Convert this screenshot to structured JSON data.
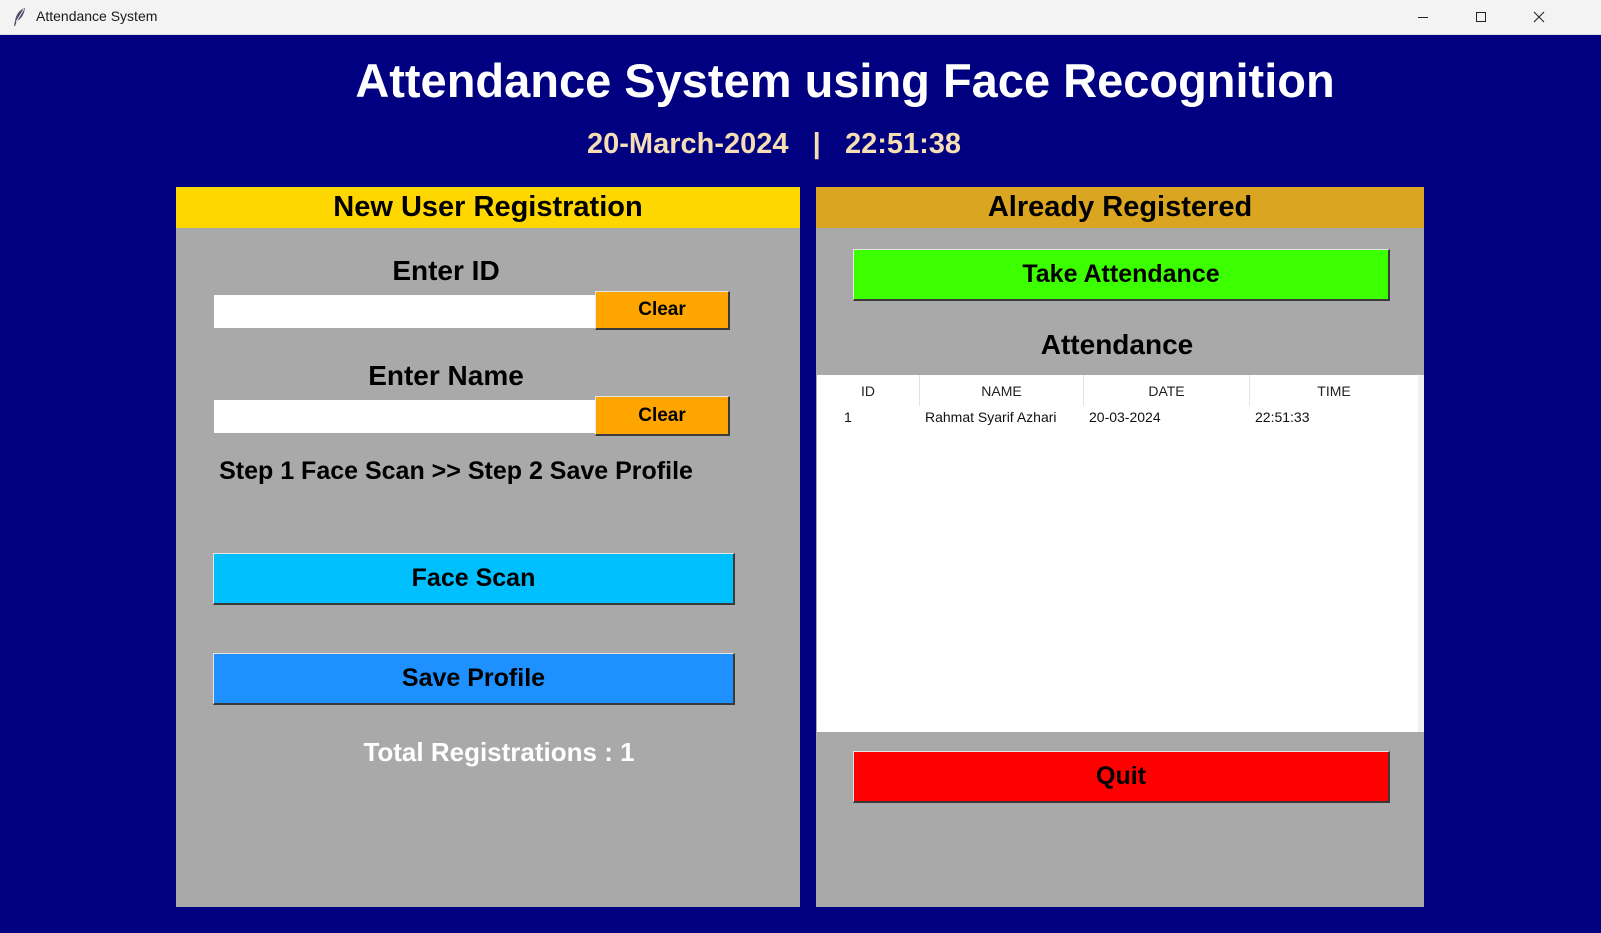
{
  "window": {
    "title": "Attendance System"
  },
  "app": {
    "heading": "Attendance System using Face Recognition",
    "date": "20-March-2024",
    "separator": "|",
    "time": "22:51:38"
  },
  "left_panel": {
    "header": "New User Registration",
    "id_label": "Enter ID",
    "id_value": "",
    "id_clear": "Clear",
    "name_label": "Enter Name",
    "name_value": "",
    "name_clear": "Clear",
    "steps": "Step 1 Face Scan >> Step 2 Save Profile",
    "face_scan": "Face Scan",
    "save_profile": "Save Profile",
    "total": "Total Registrations : 1"
  },
  "right_panel": {
    "header": "Already Registered",
    "take_attendance": "Take Attendance",
    "attendance_label": "Attendance",
    "columns": [
      "ID",
      "NAME",
      "DATE",
      "TIME"
    ],
    "rows": [
      [
        "1",
        "Rahmat Syarif Azhari",
        "20-03-2024",
        "22:51:33"
      ]
    ],
    "quit": "Quit"
  },
  "colors": {
    "background": "#000080",
    "panel": "#a9a9a9",
    "left_header": "#ffd700",
    "right_header": "#daa520",
    "clear_button": "#ffa500",
    "face_scan_button": "#00bfff",
    "save_profile_button": "#1e90ff",
    "take_attendance_button": "#3cff00",
    "quit_button": "#ff0000",
    "datetime_text": "#f5deb3"
  },
  "icons": [
    "feather-icon",
    "minimize-icon",
    "maximize-icon",
    "close-icon"
  ]
}
